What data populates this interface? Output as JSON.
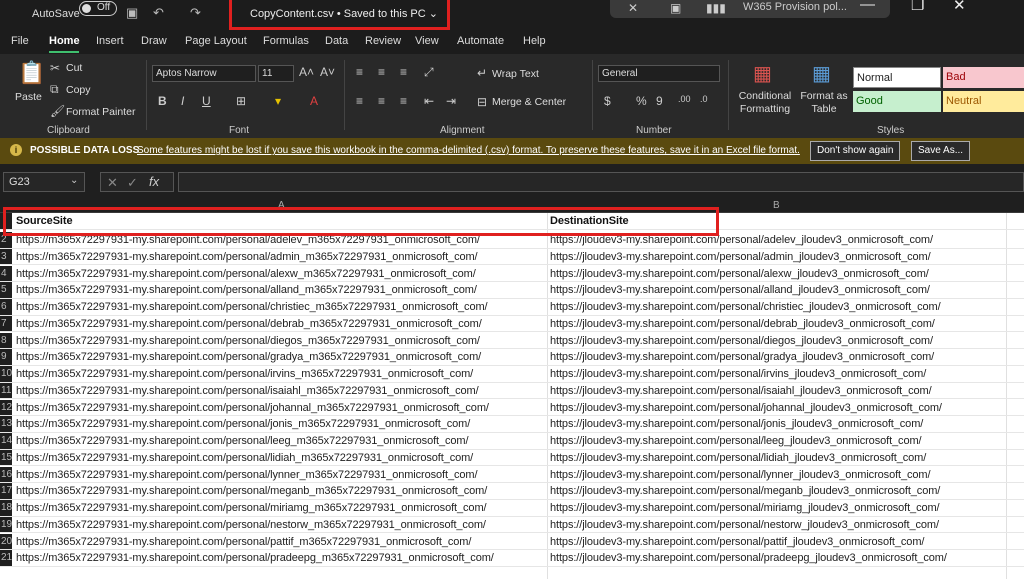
{
  "titlebar": {
    "autosave_label": "AutoSave",
    "autosave_state": "Off",
    "doc_title": "CopyContent.csv • Saved to this PC ⌄",
    "pill_label": "W365 Provision pol..."
  },
  "menu": [
    "File",
    "Home",
    "Insert",
    "Draw",
    "Page Layout",
    "Formulas",
    "Data",
    "Review",
    "View",
    "Automate",
    "Help"
  ],
  "ribbon": {
    "clipboard": {
      "paste": "Paste",
      "cut": "Cut",
      "copy": "Copy",
      "format_painter": "Format Painter",
      "group": "Clipboard"
    },
    "font": {
      "family": "Aptos Narrow",
      "size": "11",
      "group": "Font"
    },
    "alignment": {
      "wrap": "Wrap Text",
      "merge": "Merge & Center",
      "group": "Alignment"
    },
    "number": {
      "format": "General",
      "group": "Number"
    },
    "styles": {
      "cond": "Conditional Formatting",
      "table": "Format as Table",
      "normal": "Normal",
      "bad": "Bad",
      "good": "Good",
      "neutral": "Neutral",
      "group": "Styles"
    }
  },
  "message": {
    "title": "POSSIBLE DATA LOSS",
    "text": "Some features might be lost if you save this workbook in the comma-delimited (.csv) format. To preserve these features, save it in an Excel file format.",
    "dont_show": "Don't show again",
    "save_as": "Save As..."
  },
  "formula_bar": {
    "namebox": "G23",
    "fx": "fx"
  },
  "columns": [
    "A",
    "B"
  ],
  "sheet": {
    "header": {
      "a": "SourceSite",
      "b": "DestinationSite"
    },
    "rows": [
      {
        "n": "2",
        "a": "https://m365x72297931-my.sharepoint.com/personal/adelev_m365x72297931_onmicrosoft_com/",
        "b": "https://jloudev3-my.sharepoint.com/personal/adelev_jloudev3_onmicrosoft_com/"
      },
      {
        "n": "3",
        "a": "https://m365x72297931-my.sharepoint.com/personal/admin_m365x72297931_onmicrosoft_com/",
        "b": "https://jloudev3-my.sharepoint.com/personal/admin_jloudev3_onmicrosoft_com/"
      },
      {
        "n": "4",
        "a": "https://m365x72297931-my.sharepoint.com/personal/alexw_m365x72297931_onmicrosoft_com/",
        "b": "https://jloudev3-my.sharepoint.com/personal/alexw_jloudev3_onmicrosoft_com/"
      },
      {
        "n": "5",
        "a": "https://m365x72297931-my.sharepoint.com/personal/alland_m365x72297931_onmicrosoft_com/",
        "b": "https://jloudev3-my.sharepoint.com/personal/alland_jloudev3_onmicrosoft_com/"
      },
      {
        "n": "6",
        "a": "https://m365x72297931-my.sharepoint.com/personal/christiec_m365x72297931_onmicrosoft_com/",
        "b": "https://jloudev3-my.sharepoint.com/personal/christiec_jloudev3_onmicrosoft_com/"
      },
      {
        "n": "7",
        "a": "https://m365x72297931-my.sharepoint.com/personal/debrab_m365x72297931_onmicrosoft_com/",
        "b": "https://jloudev3-my.sharepoint.com/personal/debrab_jloudev3_onmicrosoft_com/"
      },
      {
        "n": "8",
        "a": "https://m365x72297931-my.sharepoint.com/personal/diegos_m365x72297931_onmicrosoft_com/",
        "b": "https://jloudev3-my.sharepoint.com/personal/diegos_jloudev3_onmicrosoft_com/"
      },
      {
        "n": "9",
        "a": "https://m365x72297931-my.sharepoint.com/personal/gradya_m365x72297931_onmicrosoft_com/",
        "b": "https://jloudev3-my.sharepoint.com/personal/gradya_jloudev3_onmicrosoft_com/"
      },
      {
        "n": "10",
        "a": "https://m365x72297931-my.sharepoint.com/personal/irvins_m365x72297931_onmicrosoft_com/",
        "b": "https://jloudev3-my.sharepoint.com/personal/irvins_jloudev3_onmicrosoft_com/"
      },
      {
        "n": "11",
        "a": "https://m365x72297931-my.sharepoint.com/personal/isaiahl_m365x72297931_onmicrosoft_com/",
        "b": "https://jloudev3-my.sharepoint.com/personal/isaiahl_jloudev3_onmicrosoft_com/"
      },
      {
        "n": "12",
        "a": "https://m365x72297931-my.sharepoint.com/personal/johannal_m365x72297931_onmicrosoft_com/",
        "b": "https://jloudev3-my.sharepoint.com/personal/johannal_jloudev3_onmicrosoft_com/"
      },
      {
        "n": "13",
        "a": "https://m365x72297931-my.sharepoint.com/personal/jonis_m365x72297931_onmicrosoft_com/",
        "b": "https://jloudev3-my.sharepoint.com/personal/jonis_jloudev3_onmicrosoft_com/"
      },
      {
        "n": "14",
        "a": "https://m365x72297931-my.sharepoint.com/personal/leeg_m365x72297931_onmicrosoft_com/",
        "b": "https://jloudev3-my.sharepoint.com/personal/leeg_jloudev3_onmicrosoft_com/"
      },
      {
        "n": "15",
        "a": "https://m365x72297931-my.sharepoint.com/personal/lidiah_m365x72297931_onmicrosoft_com/",
        "b": "https://jloudev3-my.sharepoint.com/personal/lidiah_jloudev3_onmicrosoft_com/"
      },
      {
        "n": "16",
        "a": "https://m365x72297931-my.sharepoint.com/personal/lynner_m365x72297931_onmicrosoft_com/",
        "b": "https://jloudev3-my.sharepoint.com/personal/lynner_jloudev3_onmicrosoft_com/"
      },
      {
        "n": "17",
        "a": "https://m365x72297931-my.sharepoint.com/personal/meganb_m365x72297931_onmicrosoft_com/",
        "b": "https://jloudev3-my.sharepoint.com/personal/meganb_jloudev3_onmicrosoft_com/"
      },
      {
        "n": "18",
        "a": "https://m365x72297931-my.sharepoint.com/personal/miriamg_m365x72297931_onmicrosoft_com/",
        "b": "https://jloudev3-my.sharepoint.com/personal/miriamg_jloudev3_onmicrosoft_com/"
      },
      {
        "n": "19",
        "a": "https://m365x72297931-my.sharepoint.com/personal/nestorw_m365x72297931_onmicrosoft_com/",
        "b": "https://jloudev3-my.sharepoint.com/personal/nestorw_jloudev3_onmicrosoft_com/"
      },
      {
        "n": "20",
        "a": "https://m365x72297931-my.sharepoint.com/personal/pattif_m365x72297931_onmicrosoft_com/",
        "b": "https://jloudev3-my.sharepoint.com/personal/pattif_jloudev3_onmicrosoft_com/"
      },
      {
        "n": "21",
        "a": "https://m365x72297931-my.sharepoint.com/personal/pradeepg_m365x72297931_onmicrosoft_com/",
        "b": "https://jloudev3-my.sharepoint.com/personal/pradeepg_jloudev3_onmicrosoft_com/"
      }
    ]
  }
}
